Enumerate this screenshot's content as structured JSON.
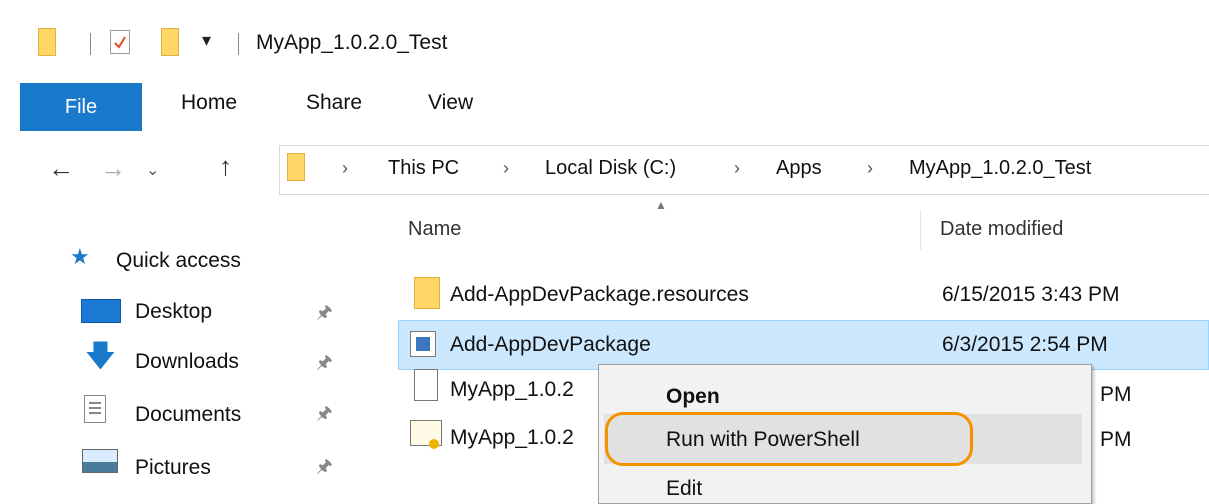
{
  "window": {
    "title": "MyApp_1.0.2.0_Test",
    "quick_access_toolbar": [
      "folder-icon",
      "properties-check-icon",
      "new-folder-icon",
      "customize-dropdown-icon"
    ]
  },
  "ribbon": {
    "tabs": [
      "File",
      "Home",
      "Share",
      "View"
    ],
    "active_tab": "File",
    "active_color": "#1979ca"
  },
  "address_bar": {
    "breadcrumbs": [
      "This PC",
      "Local Disk (C:)",
      "Apps",
      "MyApp_1.0.2.0_Test"
    ],
    "nav_buttons": [
      "back-arrow-icon",
      "forward-arrow-icon",
      "recent-locations-chevron-icon",
      "up-arrow-icon"
    ]
  },
  "columns": {
    "name": "Name",
    "date_modified": "Date modified"
  },
  "sidebar": {
    "items": [
      {
        "label": "Quick access",
        "icon": "star-icon"
      },
      {
        "label": "Desktop",
        "icon": "desktop-icon",
        "pinned": true
      },
      {
        "label": "Downloads",
        "icon": "download-arrow-icon",
        "pinned": true
      },
      {
        "label": "Documents",
        "icon": "documents-icon",
        "pinned": true
      },
      {
        "label": "Pictures",
        "icon": "pictures-icon",
        "pinned": true
      }
    ]
  },
  "files": [
    {
      "name": "Add-AppDevPackage.resources",
      "date": "6/15/2015 3:43 PM",
      "icon": "folder-icon"
    },
    {
      "name": "Add-AppDevPackage",
      "date": "6/3/2015 2:54 PM",
      "icon": "powershell-script-icon",
      "selected": true
    },
    {
      "name": "MyApp_1.0.2",
      "date": "PM",
      "icon": "blank-file-icon"
    },
    {
      "name": "MyApp_1.0.2",
      "date": "PM",
      "icon": "certificate-icon"
    }
  ],
  "context_menu": {
    "items": [
      "Open",
      "Run with PowerShell",
      "Edit"
    ],
    "highlighted": "Run with PowerShell",
    "highlight_ring_color": "#f39200"
  }
}
